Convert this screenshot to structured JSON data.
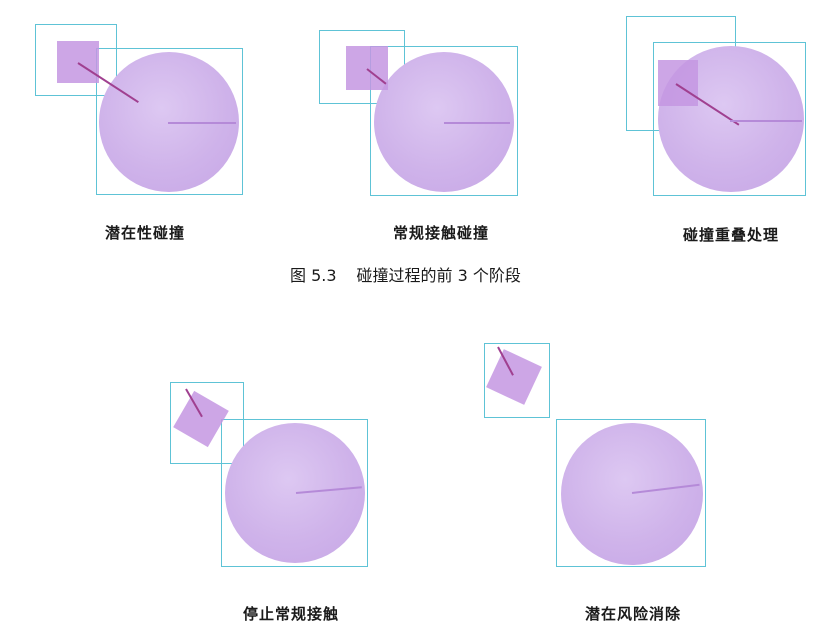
{
  "figure": {
    "number": "图 5.3",
    "title": "碰撞过程的前 3 个阶段"
  },
  "top_row": {
    "captions": [
      "潜在性碰撞",
      "常规接触碰撞",
      "碰撞重叠处理"
    ]
  },
  "bottom_row": {
    "captions": [
      "停止常规接触",
      "潜在风险消除"
    ]
  },
  "colors": {
    "bounding_box": "#5ec3d6",
    "ball": "#cfb3ea",
    "square": "#c496e2",
    "direction_line": "#a04090"
  }
}
